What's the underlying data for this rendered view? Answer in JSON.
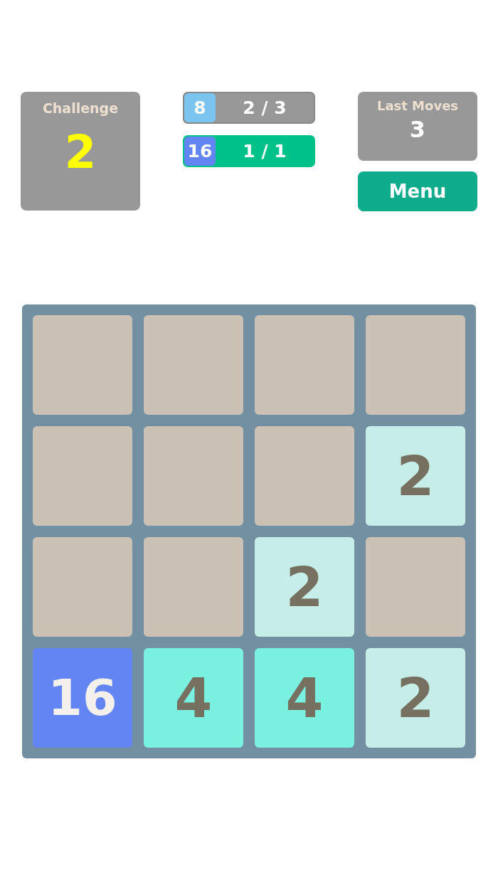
{
  "challenge": {
    "label": "Challenge",
    "value": "2"
  },
  "goals": [
    {
      "tile": "8",
      "color": "#7cc4f0",
      "progress": "2 / 3",
      "completed": false
    },
    {
      "tile": "16",
      "color": "#6285f3",
      "progress": "1 / 1",
      "completed": true
    }
  ],
  "last_moves": {
    "label": "Last Moves",
    "value": "3"
  },
  "menu_button": "Menu",
  "board": {
    "rows": [
      [
        {
          "kind": "empty",
          "color": "#cbc0b4"
        },
        {
          "kind": "empty",
          "color": "#cbc0b4"
        },
        {
          "kind": "empty",
          "color": "#cbc0b4"
        },
        {
          "kind": "empty",
          "color": "#cbc0b4"
        }
      ],
      [
        {
          "kind": "empty",
          "color": "#cbc0b4"
        },
        {
          "kind": "empty",
          "color": "#cbc0b4"
        },
        {
          "kind": "empty",
          "color": "#cbc0b4"
        },
        {
          "kind": "tile",
          "value": "2",
          "color": "#c6ede7"
        }
      ],
      [
        {
          "kind": "empty",
          "color": "#cbc0b4"
        },
        {
          "kind": "empty",
          "color": "#cbc0b4"
        },
        {
          "kind": "tile",
          "value": "2",
          "color": "#c6ede7"
        },
        {
          "kind": "empty",
          "color": "#cbc0b4"
        }
      ],
      [
        {
          "kind": "high",
          "value": "16",
          "color": "#6285f3"
        },
        {
          "kind": "tile",
          "value": "4",
          "color": "#7af0e0"
        },
        {
          "kind": "tile",
          "value": "4",
          "color": "#7af0e0"
        },
        {
          "kind": "tile",
          "value": "2",
          "color": "#c6ede7"
        }
      ]
    ]
  }
}
